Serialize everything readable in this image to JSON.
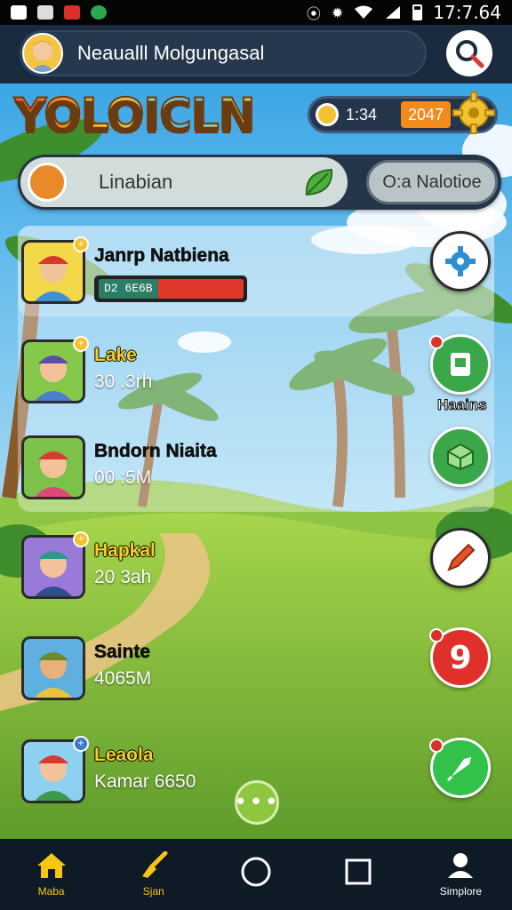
{
  "status_bar": {
    "time": "17:7.64"
  },
  "header": {
    "user_name": "Neaualll Molgungasal",
    "icons": {
      "avatar": "avatar-icon",
      "search": "search-icon"
    }
  },
  "logo": {
    "text": "YOLOICLN"
  },
  "coins": {
    "primary": "1:34",
    "secondary": "2047"
  },
  "filter": {
    "left_label": "Linabian",
    "right_label": "O:a Nalotioe"
  },
  "contacts": [
    {
      "name": "Janrp Natbiena",
      "subtitle": "",
      "progress_label": "D2 6E6B",
      "name_color": "dark"
    },
    {
      "name": "Lake",
      "subtitle": "30 .3rh",
      "name_color": "yellow"
    },
    {
      "name": "Bndorn Niaita",
      "subtitle": "00 :5M",
      "name_color": "dark"
    },
    {
      "name": "Hapkal",
      "subtitle": "20 3ah",
      "name_color": "yellow"
    },
    {
      "name": "Sainte",
      "subtitle": "4065M",
      "name_color": "dark"
    },
    {
      "name": "Leaola",
      "subtitle": "Kamar 6650",
      "name_color": "yellow"
    }
  ],
  "actions": {
    "label_second": "Haains",
    "icons": [
      "gear-icon",
      "app-icon",
      "box-icon",
      "pencil-icon",
      "number-icon",
      "rocket-icon"
    ]
  },
  "more_button": {
    "label": "•••"
  },
  "bottom_nav": [
    {
      "label": "Maba",
      "icon": "home-icon",
      "color": "#f5c518"
    },
    {
      "label": "Sjan",
      "icon": "broom-icon",
      "color": "#f5c518"
    },
    {
      "label": "",
      "icon": "circle-icon",
      "color": "#ffffff"
    },
    {
      "label": "",
      "icon": "square-icon",
      "color": "#ffffff"
    },
    {
      "label": "Simplore",
      "icon": "person-icon",
      "color": "#ffffff"
    }
  ]
}
